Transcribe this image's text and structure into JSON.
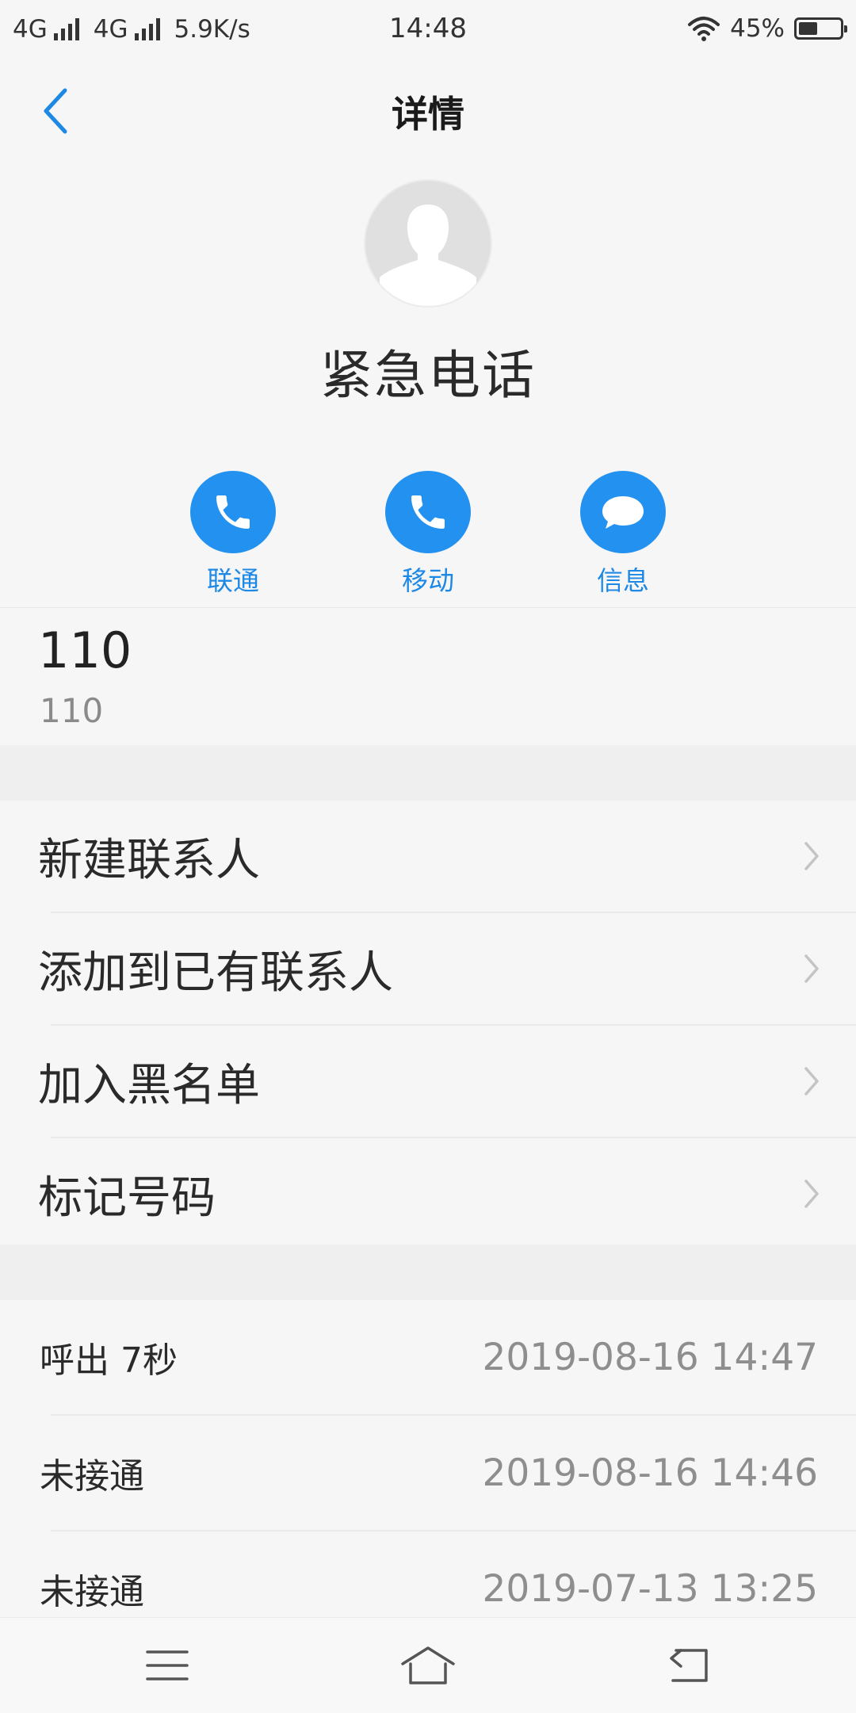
{
  "status_bar": {
    "network_1": "4G",
    "network_2": "4G",
    "speed": "5.9K/s",
    "time": "14:48",
    "battery": "45%",
    "battery_level": 0.45,
    "icons": [
      "signal-icon",
      "signal-icon",
      "wifi-icon",
      "battery-icon"
    ]
  },
  "header": {
    "title": "详情",
    "back_icon": "back-arrow-icon"
  },
  "contact": {
    "name": "紧急电话",
    "avatar_icon": "default-avatar-icon"
  },
  "actions": [
    {
      "label": "联通",
      "icon": "phone-icon"
    },
    {
      "label": "移动",
      "icon": "phone-icon"
    },
    {
      "label": "信息",
      "icon": "message-icon"
    }
  ],
  "number": {
    "main": "110",
    "sub": "110"
  },
  "menu": [
    {
      "label": "新建联系人"
    },
    {
      "label": "添加到已有联系人"
    },
    {
      "label": "加入黑名单"
    },
    {
      "label": "标记号码"
    }
  ],
  "call_log": [
    {
      "type": "呼出 7秒",
      "time": "2019-08-16 14:47"
    },
    {
      "type": "未接通",
      "time": "2019-08-16 14:46"
    },
    {
      "type": "未接通",
      "time": "2019-07-13 13:25"
    }
  ],
  "nav_icons": [
    "menu-icon",
    "home-icon",
    "back-icon"
  ],
  "colors": {
    "accent": "#2391f0",
    "background": "#f6f6f6",
    "secondary_text": "#8e8e8e"
  }
}
